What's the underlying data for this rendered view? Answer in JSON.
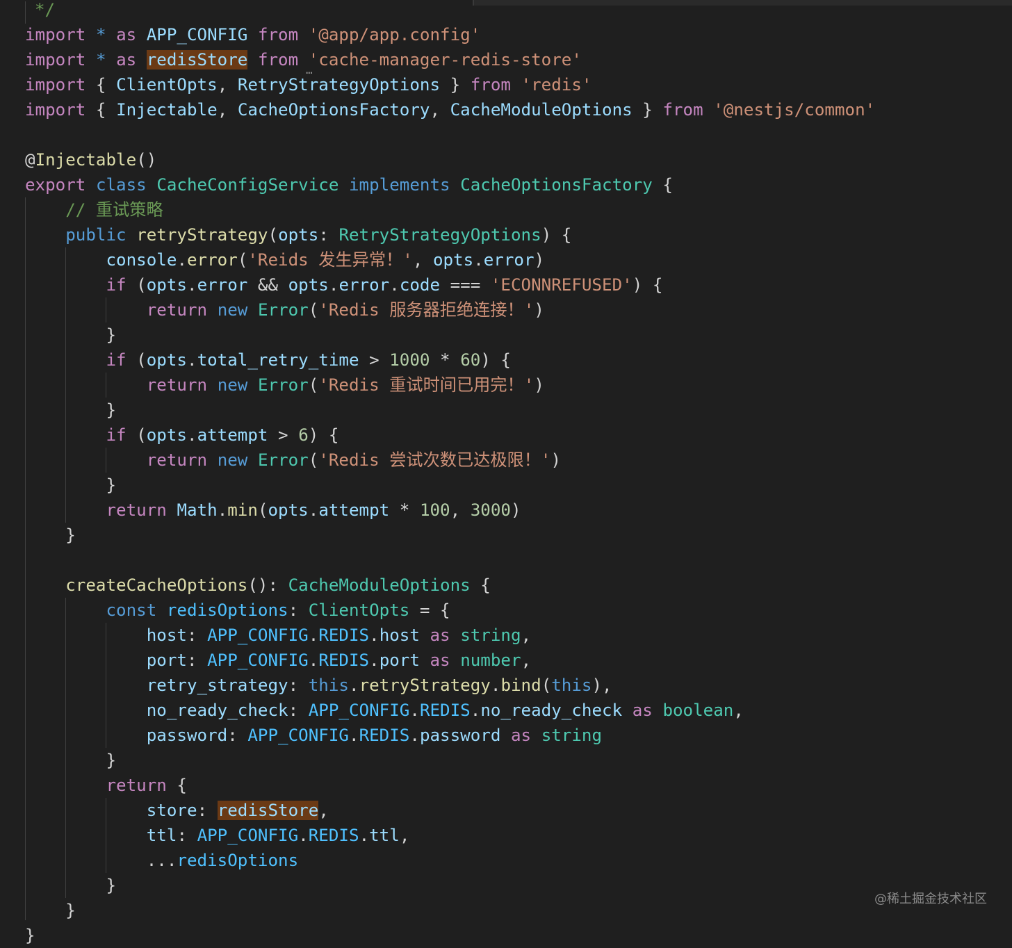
{
  "editor": {
    "lines": [
      [
        {
          "t": "*/",
          "c": "com"
        }
      ],
      [
        {
          "t": "import",
          "c": "kw"
        },
        {
          "t": " ",
          "c": "pun"
        },
        {
          "t": "*",
          "c": "kw2"
        },
        {
          "t": " ",
          "c": "pun"
        },
        {
          "t": "as",
          "c": "kw"
        },
        {
          "t": " ",
          "c": "pun"
        },
        {
          "t": "APP_CONFIG",
          "c": "var"
        },
        {
          "t": " ",
          "c": "pun"
        },
        {
          "t": "from",
          "c": "kw"
        },
        {
          "t": " ",
          "c": "pun"
        },
        {
          "t": "'@app/app.config'",
          "c": "str"
        }
      ],
      [
        {
          "t": "import",
          "c": "kw"
        },
        {
          "t": " ",
          "c": "pun"
        },
        {
          "t": "*",
          "c": "kw2"
        },
        {
          "t": " ",
          "c": "pun"
        },
        {
          "t": "as",
          "c": "kw"
        },
        {
          "t": " ",
          "c": "pun"
        },
        {
          "t": "redisStore",
          "c": "var hl"
        },
        {
          "t": " ",
          "c": "pun"
        },
        {
          "t": "from",
          "c": "kw"
        },
        {
          "t": " ",
          "c": "pun"
        },
        {
          "t": "'cache-manager-redis-store'",
          "c": "str"
        }
      ],
      [
        {
          "t": "import",
          "c": "kw"
        },
        {
          "t": " { ",
          "c": "pun"
        },
        {
          "t": "ClientOpts",
          "c": "var"
        },
        {
          "t": ", ",
          "c": "pun"
        },
        {
          "t": "RetryStrategyOptions",
          "c": "var"
        },
        {
          "t": " } ",
          "c": "pun"
        },
        {
          "t": "from",
          "c": "kw"
        },
        {
          "t": " ",
          "c": "pun"
        },
        {
          "t": "'redis'",
          "c": "str"
        }
      ],
      [
        {
          "t": "import",
          "c": "kw"
        },
        {
          "t": " { ",
          "c": "pun"
        },
        {
          "t": "Injectable",
          "c": "var"
        },
        {
          "t": ", ",
          "c": "pun"
        },
        {
          "t": "CacheOptionsFactory",
          "c": "var"
        },
        {
          "t": ", ",
          "c": "pun"
        },
        {
          "t": "CacheModuleOptions",
          "c": "var"
        },
        {
          "t": " } ",
          "c": "pun"
        },
        {
          "t": "from",
          "c": "kw"
        },
        {
          "t": " ",
          "c": "pun"
        },
        {
          "t": "'@nestjs/common'",
          "c": "str"
        }
      ],
      [],
      [
        {
          "t": "@",
          "c": "pun"
        },
        {
          "t": "Injectable",
          "c": "fn"
        },
        {
          "t": "()",
          "c": "pun"
        }
      ],
      [
        {
          "t": "export",
          "c": "kw"
        },
        {
          "t": " ",
          "c": "pun"
        },
        {
          "t": "class",
          "c": "kw2"
        },
        {
          "t": " ",
          "c": "pun"
        },
        {
          "t": "CacheConfigService",
          "c": "cls"
        },
        {
          "t": " ",
          "c": "pun"
        },
        {
          "t": "implements",
          "c": "kw2"
        },
        {
          "t": " ",
          "c": "pun"
        },
        {
          "t": "CacheOptionsFactory",
          "c": "cls"
        },
        {
          "t": " {",
          "c": "pun"
        }
      ],
      [
        {
          "t": "    ",
          "c": "pun"
        },
        {
          "t": "// 重试策略",
          "c": "com"
        }
      ],
      [
        {
          "t": "    ",
          "c": "pun"
        },
        {
          "t": "public",
          "c": "kw2"
        },
        {
          "t": " ",
          "c": "pun"
        },
        {
          "t": "retryStrategy",
          "c": "fn"
        },
        {
          "t": "(",
          "c": "pun"
        },
        {
          "t": "opts",
          "c": "var"
        },
        {
          "t": ": ",
          "c": "pun"
        },
        {
          "t": "RetryStrategyOptions",
          "c": "cls"
        },
        {
          "t": ") {",
          "c": "pun"
        }
      ],
      [
        {
          "t": "        ",
          "c": "pun"
        },
        {
          "t": "console",
          "c": "var"
        },
        {
          "t": ".",
          "c": "pun"
        },
        {
          "t": "error",
          "c": "fn"
        },
        {
          "t": "(",
          "c": "pun"
        },
        {
          "t": "'Reids 发生异常！'",
          "c": "str"
        },
        {
          "t": ", ",
          "c": "pun"
        },
        {
          "t": "opts",
          "c": "var"
        },
        {
          "t": ".",
          "c": "pun"
        },
        {
          "t": "error",
          "c": "var"
        },
        {
          "t": ")",
          "c": "pun"
        }
      ],
      [
        {
          "t": "        ",
          "c": "pun"
        },
        {
          "t": "if",
          "c": "kw"
        },
        {
          "t": " (",
          "c": "pun"
        },
        {
          "t": "opts",
          "c": "var"
        },
        {
          "t": ".",
          "c": "pun"
        },
        {
          "t": "error",
          "c": "var"
        },
        {
          "t": " && ",
          "c": "pun"
        },
        {
          "t": "opts",
          "c": "var"
        },
        {
          "t": ".",
          "c": "pun"
        },
        {
          "t": "error",
          "c": "var"
        },
        {
          "t": ".",
          "c": "pun"
        },
        {
          "t": "code",
          "c": "var"
        },
        {
          "t": " === ",
          "c": "pun"
        },
        {
          "t": "'ECONNREFUSED'",
          "c": "str"
        },
        {
          "t": ") {",
          "c": "pun"
        }
      ],
      [
        {
          "t": "            ",
          "c": "pun"
        },
        {
          "t": "return",
          "c": "kw"
        },
        {
          "t": " ",
          "c": "pun"
        },
        {
          "t": "new",
          "c": "kw2"
        },
        {
          "t": " ",
          "c": "pun"
        },
        {
          "t": "Error",
          "c": "cls"
        },
        {
          "t": "(",
          "c": "pun"
        },
        {
          "t": "'Redis 服务器拒绝连接！'",
          "c": "str"
        },
        {
          "t": ")",
          "c": "pun"
        }
      ],
      [
        {
          "t": "        }",
          "c": "pun"
        }
      ],
      [
        {
          "t": "        ",
          "c": "pun"
        },
        {
          "t": "if",
          "c": "kw"
        },
        {
          "t": " (",
          "c": "pun"
        },
        {
          "t": "opts",
          "c": "var"
        },
        {
          "t": ".",
          "c": "pun"
        },
        {
          "t": "total_retry_time",
          "c": "var"
        },
        {
          "t": " > ",
          "c": "pun"
        },
        {
          "t": "1000",
          "c": "num"
        },
        {
          "t": " * ",
          "c": "pun"
        },
        {
          "t": "60",
          "c": "num"
        },
        {
          "t": ") {",
          "c": "pun"
        }
      ],
      [
        {
          "t": "            ",
          "c": "pun"
        },
        {
          "t": "return",
          "c": "kw"
        },
        {
          "t": " ",
          "c": "pun"
        },
        {
          "t": "new",
          "c": "kw2"
        },
        {
          "t": " ",
          "c": "pun"
        },
        {
          "t": "Error",
          "c": "cls"
        },
        {
          "t": "(",
          "c": "pun"
        },
        {
          "t": "'Redis 重试时间已用完！'",
          "c": "str"
        },
        {
          "t": ")",
          "c": "pun"
        }
      ],
      [
        {
          "t": "        }",
          "c": "pun"
        }
      ],
      [
        {
          "t": "        ",
          "c": "pun"
        },
        {
          "t": "if",
          "c": "kw"
        },
        {
          "t": " (",
          "c": "pun"
        },
        {
          "t": "opts",
          "c": "var"
        },
        {
          "t": ".",
          "c": "pun"
        },
        {
          "t": "attempt",
          "c": "var"
        },
        {
          "t": " > ",
          "c": "pun"
        },
        {
          "t": "6",
          "c": "num"
        },
        {
          "t": ") {",
          "c": "pun"
        }
      ],
      [
        {
          "t": "            ",
          "c": "pun"
        },
        {
          "t": "return",
          "c": "kw"
        },
        {
          "t": " ",
          "c": "pun"
        },
        {
          "t": "new",
          "c": "kw2"
        },
        {
          "t": " ",
          "c": "pun"
        },
        {
          "t": "Error",
          "c": "cls"
        },
        {
          "t": "(",
          "c": "pun"
        },
        {
          "t": "'Redis 尝试次数已达极限！'",
          "c": "str"
        },
        {
          "t": ")",
          "c": "pun"
        }
      ],
      [
        {
          "t": "        }",
          "c": "pun"
        }
      ],
      [
        {
          "t": "        ",
          "c": "pun"
        },
        {
          "t": "return",
          "c": "kw"
        },
        {
          "t": " ",
          "c": "pun"
        },
        {
          "t": "Math",
          "c": "var"
        },
        {
          "t": ".",
          "c": "pun"
        },
        {
          "t": "min",
          "c": "fn"
        },
        {
          "t": "(",
          "c": "pun"
        },
        {
          "t": "opts",
          "c": "var"
        },
        {
          "t": ".",
          "c": "pun"
        },
        {
          "t": "attempt",
          "c": "var"
        },
        {
          "t": " * ",
          "c": "pun"
        },
        {
          "t": "100",
          "c": "num"
        },
        {
          "t": ", ",
          "c": "pun"
        },
        {
          "t": "3000",
          "c": "num"
        },
        {
          "t": ")",
          "c": "pun"
        }
      ],
      [
        {
          "t": "    }",
          "c": "pun"
        }
      ],
      [],
      [
        {
          "t": "    ",
          "c": "pun"
        },
        {
          "t": "createCacheOptions",
          "c": "fn"
        },
        {
          "t": "(): ",
          "c": "pun"
        },
        {
          "t": "CacheModuleOptions",
          "c": "cls"
        },
        {
          "t": " {",
          "c": "pun"
        }
      ],
      [
        {
          "t": "        ",
          "c": "pun"
        },
        {
          "t": "const",
          "c": "kw2"
        },
        {
          "t": " ",
          "c": "pun"
        },
        {
          "t": "redisOptions",
          "c": "const"
        },
        {
          "t": ": ",
          "c": "pun"
        },
        {
          "t": "ClientOpts",
          "c": "cls"
        },
        {
          "t": " = {",
          "c": "pun"
        }
      ],
      [
        {
          "t": "            ",
          "c": "pun"
        },
        {
          "t": "host",
          "c": "var"
        },
        {
          "t": ": ",
          "c": "pun"
        },
        {
          "t": "APP_CONFIG",
          "c": "const"
        },
        {
          "t": ".",
          "c": "pun"
        },
        {
          "t": "REDIS",
          "c": "const"
        },
        {
          "t": ".",
          "c": "pun"
        },
        {
          "t": "host",
          "c": "var"
        },
        {
          "t": " ",
          "c": "pun"
        },
        {
          "t": "as",
          "c": "kw"
        },
        {
          "t": " ",
          "c": "pun"
        },
        {
          "t": "string",
          "c": "cls"
        },
        {
          "t": ",",
          "c": "pun"
        }
      ],
      [
        {
          "t": "            ",
          "c": "pun"
        },
        {
          "t": "port",
          "c": "var"
        },
        {
          "t": ": ",
          "c": "pun"
        },
        {
          "t": "APP_CONFIG",
          "c": "const"
        },
        {
          "t": ".",
          "c": "pun"
        },
        {
          "t": "REDIS",
          "c": "const"
        },
        {
          "t": ".",
          "c": "pun"
        },
        {
          "t": "port",
          "c": "var"
        },
        {
          "t": " ",
          "c": "pun"
        },
        {
          "t": "as",
          "c": "kw"
        },
        {
          "t": " ",
          "c": "pun"
        },
        {
          "t": "number",
          "c": "cls"
        },
        {
          "t": ",",
          "c": "pun"
        }
      ],
      [
        {
          "t": "            ",
          "c": "pun"
        },
        {
          "t": "retry_strategy",
          "c": "var"
        },
        {
          "t": ": ",
          "c": "pun"
        },
        {
          "t": "this",
          "c": "kw2"
        },
        {
          "t": ".",
          "c": "pun"
        },
        {
          "t": "retryStrategy",
          "c": "fn"
        },
        {
          "t": ".",
          "c": "pun"
        },
        {
          "t": "bind",
          "c": "fn"
        },
        {
          "t": "(",
          "c": "pun"
        },
        {
          "t": "this",
          "c": "kw2"
        },
        {
          "t": "),",
          "c": "pun"
        }
      ],
      [
        {
          "t": "            ",
          "c": "pun"
        },
        {
          "t": "no_ready_check",
          "c": "var"
        },
        {
          "t": ": ",
          "c": "pun"
        },
        {
          "t": "APP_CONFIG",
          "c": "const"
        },
        {
          "t": ".",
          "c": "pun"
        },
        {
          "t": "REDIS",
          "c": "const"
        },
        {
          "t": ".",
          "c": "pun"
        },
        {
          "t": "no_ready_check",
          "c": "var"
        },
        {
          "t": " ",
          "c": "pun"
        },
        {
          "t": "as",
          "c": "kw"
        },
        {
          "t": " ",
          "c": "pun"
        },
        {
          "t": "boolean",
          "c": "cls"
        },
        {
          "t": ",",
          "c": "pun"
        }
      ],
      [
        {
          "t": "            ",
          "c": "pun"
        },
        {
          "t": "password",
          "c": "var"
        },
        {
          "t": ": ",
          "c": "pun"
        },
        {
          "t": "APP_CONFIG",
          "c": "const"
        },
        {
          "t": ".",
          "c": "pun"
        },
        {
          "t": "REDIS",
          "c": "const"
        },
        {
          "t": ".",
          "c": "pun"
        },
        {
          "t": "password",
          "c": "var"
        },
        {
          "t": " ",
          "c": "pun"
        },
        {
          "t": "as",
          "c": "kw"
        },
        {
          "t": " ",
          "c": "pun"
        },
        {
          "t": "string",
          "c": "cls"
        }
      ],
      [
        {
          "t": "        }",
          "c": "pun"
        }
      ],
      [
        {
          "t": "        ",
          "c": "pun"
        },
        {
          "t": "return",
          "c": "kw"
        },
        {
          "t": " {",
          "c": "pun"
        }
      ],
      [
        {
          "t": "            ",
          "c": "pun"
        },
        {
          "t": "store",
          "c": "var"
        },
        {
          "t": ": ",
          "c": "pun"
        },
        {
          "t": "redisStore",
          "c": "var hl"
        },
        {
          "t": ",",
          "c": "pun"
        }
      ],
      [
        {
          "t": "            ",
          "c": "pun"
        },
        {
          "t": "ttl",
          "c": "var"
        },
        {
          "t": ": ",
          "c": "pun"
        },
        {
          "t": "APP_CONFIG",
          "c": "const"
        },
        {
          "t": ".",
          "c": "pun"
        },
        {
          "t": "REDIS",
          "c": "const"
        },
        {
          "t": ".",
          "c": "pun"
        },
        {
          "t": "ttl",
          "c": "var"
        },
        {
          "t": ",",
          "c": "pun"
        }
      ],
      [
        {
          "t": "            ",
          "c": "pun"
        },
        {
          "t": "...",
          "c": "pun"
        },
        {
          "t": "redisOptions",
          "c": "const"
        }
      ],
      [
        {
          "t": "        }",
          "c": "pun"
        }
      ],
      [
        {
          "t": "    }",
          "c": "pun"
        }
      ],
      [
        {
          "t": "}",
          "c": "pun"
        }
      ]
    ]
  },
  "watermark": "@稀土掘金技术社区"
}
